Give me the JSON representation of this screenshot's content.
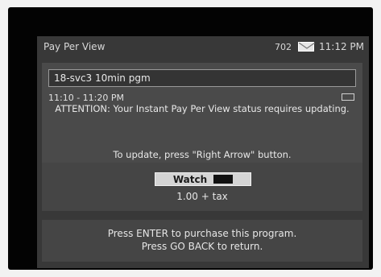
{
  "header": {
    "title": "Pay Per View",
    "channel": "702",
    "clock": "11:12 PM",
    "mail_icon": "envelope-icon"
  },
  "program": {
    "name": "18-svc3 10min pgm",
    "time": "11:10 - 11:20 PM",
    "cc_icon": "closed-caption-icon"
  },
  "messages": {
    "attention": "ATTENTION: Your Instant Pay Per View status requires updating.",
    "update": "To update, press \"Right Arrow\" button."
  },
  "purchase": {
    "watch_label": "Watch",
    "price": "1.00 + tax"
  },
  "instructions": {
    "line1": "Press ENTER to purchase this program.",
    "line2": "Press GO BACK to return."
  }
}
